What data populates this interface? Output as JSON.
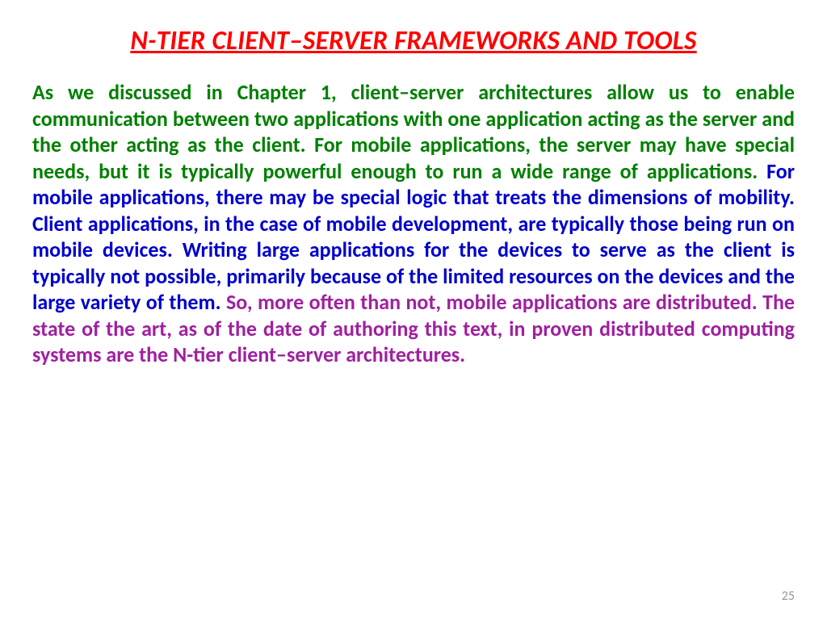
{
  "title": "N-TIER CLIENT–SERVER FRAMEWORKS AND TOOLS",
  "paragraph": {
    "segment_green": "As we discussed in Chapter 1, client–server architectures allow us to enable communication between two applications with one application acting as the server and the other acting as the client. For mobile applications, the server may have special needs, but it is typically powerful enough to run a wide range of applications. ",
    "segment_blue": "For mobile applications, there may be special logic that treats the dimensions of mobility. Client applications, in the case of mobile development, are typically those being run on mobile devices. Writing large applications for the devices to serve as the client is typically not possible, primarily because of the limited resources on the devices and the large variety of them. ",
    "segment_purple": "So, more often than not, mobile applications are distributed. The state of the art, as of the date of authoring this text, in proven distributed computing systems are the N-tier client–server architectures."
  },
  "page_number": "25"
}
